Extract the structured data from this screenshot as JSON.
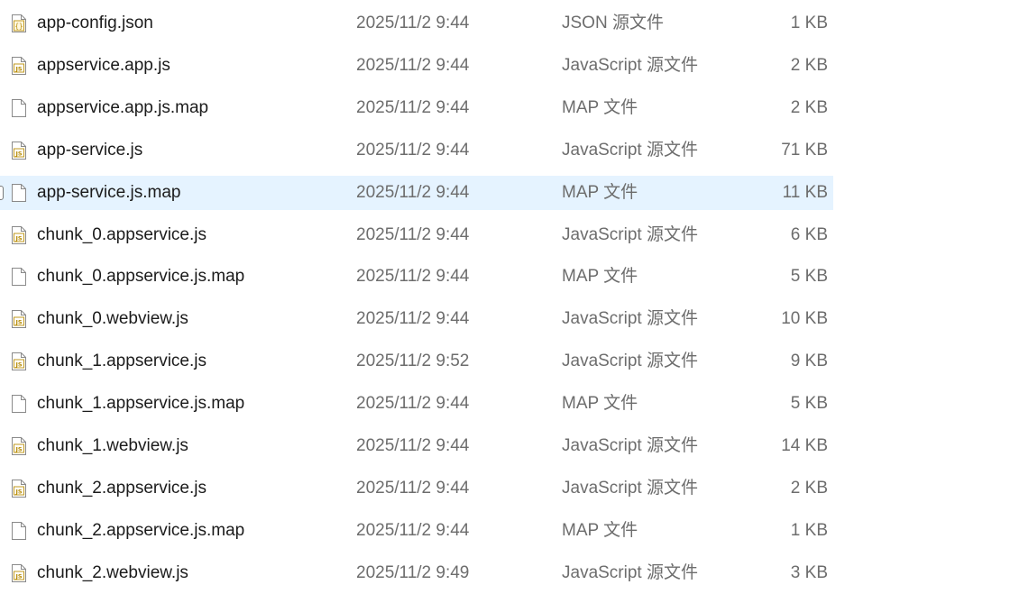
{
  "files": [
    {
      "name": "app-config.json",
      "date": "2025/11/2 9:44",
      "type": "JSON 源文件",
      "size": "1 KB",
      "icon": "json-file-icon",
      "selected": false
    },
    {
      "name": "appservice.app.js",
      "date": "2025/11/2 9:44",
      "type": "JavaScript 源文件",
      "size": "2 KB",
      "icon": "js-file-icon",
      "selected": false
    },
    {
      "name": "appservice.app.js.map",
      "date": "2025/11/2 9:44",
      "type": "MAP 文件",
      "size": "2 KB",
      "icon": "blank-file-icon",
      "selected": false
    },
    {
      "name": "app-service.js",
      "date": "2025/11/2 9:44",
      "type": "JavaScript 源文件",
      "size": "71 KB",
      "icon": "js-file-icon",
      "selected": false
    },
    {
      "name": "app-service.js.map",
      "date": "2025/11/2 9:44",
      "type": "MAP 文件",
      "size": "11 KB",
      "icon": "blank-file-icon",
      "selected": true
    },
    {
      "name": "chunk_0.appservice.js",
      "date": "2025/11/2 9:44",
      "type": "JavaScript 源文件",
      "size": "6 KB",
      "icon": "js-file-icon",
      "selected": false
    },
    {
      "name": "chunk_0.appservice.js.map",
      "date": "2025/11/2 9:44",
      "type": "MAP 文件",
      "size": "5 KB",
      "icon": "blank-file-icon",
      "selected": false
    },
    {
      "name": "chunk_0.webview.js",
      "date": "2025/11/2 9:44",
      "type": "JavaScript 源文件",
      "size": "10 KB",
      "icon": "js-file-icon",
      "selected": false
    },
    {
      "name": "chunk_1.appservice.js",
      "date": "2025/11/2 9:52",
      "type": "JavaScript 源文件",
      "size": "9 KB",
      "icon": "js-file-icon",
      "selected": false
    },
    {
      "name": "chunk_1.appservice.js.map",
      "date": "2025/11/2 9:44",
      "type": "MAP 文件",
      "size": "5 KB",
      "icon": "blank-file-icon",
      "selected": false
    },
    {
      "name": "chunk_1.webview.js",
      "date": "2025/11/2 9:44",
      "type": "JavaScript 源文件",
      "size": "14 KB",
      "icon": "js-file-icon",
      "selected": false
    },
    {
      "name": "chunk_2.appservice.js",
      "date": "2025/11/2 9:44",
      "type": "JavaScript 源文件",
      "size": "2 KB",
      "icon": "js-file-icon",
      "selected": false
    },
    {
      "name": "chunk_2.appservice.js.map",
      "date": "2025/11/2 9:44",
      "type": "MAP 文件",
      "size": "1 KB",
      "icon": "blank-file-icon",
      "selected": false
    },
    {
      "name": "chunk_2.webview.js",
      "date": "2025/11/2 9:49",
      "type": "JavaScript 源文件",
      "size": "3 KB",
      "icon": "js-file-icon",
      "selected": false
    }
  ],
  "colors": {
    "selected_row": "#e5f3ff",
    "js_badge": "#b58900",
    "json_badge": "#b58900"
  }
}
